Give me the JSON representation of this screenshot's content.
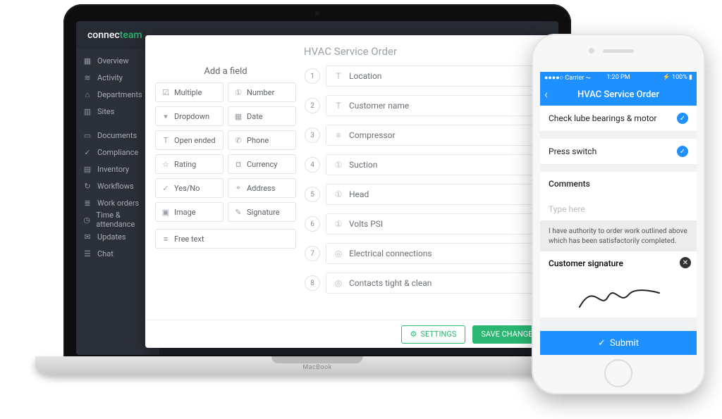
{
  "brand": {
    "part1": "connec",
    "part2": "team",
    "laptop": "MacBook"
  },
  "sidebar": {
    "items_top": [
      {
        "icon": "▦",
        "label": "Overview"
      },
      {
        "icon": "≋",
        "label": "Activity"
      },
      {
        "icon": "⌂",
        "label": "Departments"
      },
      {
        "icon": "▥",
        "label": "Sites"
      }
    ],
    "items_mid": [
      {
        "icon": "▭",
        "label": "Documents"
      },
      {
        "icon": "✓",
        "label": "Compliance"
      },
      {
        "icon": "▤",
        "label": "Inventory"
      },
      {
        "icon": "↻",
        "label": "Workflows"
      },
      {
        "icon": "≣",
        "label": "Work orders"
      },
      {
        "icon": "◷",
        "label": "Time & attendance"
      },
      {
        "icon": "✉",
        "label": "Updates"
      },
      {
        "icon": "☰",
        "label": "Chat"
      }
    ]
  },
  "modal": {
    "title": "HVAC Service Order",
    "add_field_heading": "Add a field",
    "palette": [
      {
        "icon": "☑",
        "label": "Multiple"
      },
      {
        "icon": "①",
        "label": "Number"
      },
      {
        "icon": "▾",
        "label": "Dropdown"
      },
      {
        "icon": "▦",
        "label": "Date"
      },
      {
        "icon": "T",
        "label": "Open ended"
      },
      {
        "icon": "✆",
        "label": "Phone"
      },
      {
        "icon": "☆",
        "label": "Rating"
      },
      {
        "icon": "¤",
        "label": "Currency"
      },
      {
        "icon": "✓",
        "label": "Yes/No"
      },
      {
        "icon": "⌖",
        "label": "Address"
      },
      {
        "icon": "▣",
        "label": "Image"
      },
      {
        "icon": "✎",
        "label": "Signature"
      }
    ],
    "palette_extra": {
      "icon": "≡",
      "label": "Free text"
    },
    "fields": [
      {
        "n": "1",
        "icon": "T",
        "label": "Location"
      },
      {
        "n": "2",
        "icon": "T",
        "label": "Customer name"
      },
      {
        "n": "3",
        "icon": "≡",
        "label": "Compressor"
      },
      {
        "n": "4",
        "icon": "①",
        "label": "Suction"
      },
      {
        "n": "5",
        "icon": "①",
        "label": "Head"
      },
      {
        "n": "6",
        "icon": "①",
        "label": "Volts PSI"
      },
      {
        "n": "7",
        "icon": "◎",
        "label": "Electrical connections"
      },
      {
        "n": "8",
        "icon": "◎",
        "label": "Contacts tight & clean"
      }
    ],
    "settings_label": "SETTINGS",
    "save_label": "SAVE CHANGES"
  },
  "phone": {
    "status": {
      "carrier": "●●●●○ Carrier ⏦",
      "time": "1:20 PM",
      "battery": "⚡ 100% ▮"
    },
    "nav_title": "HVAC Service Order",
    "tasks": [
      "Check lube bearings & motor",
      "Press switch"
    ],
    "comments_label": "Comments",
    "comments_placeholder": "Type here",
    "disclaimer": "I have authority to order work outlined above which has been satisfactorily completed.",
    "signature_label": "Customer signature",
    "submit_label": "Submit"
  }
}
